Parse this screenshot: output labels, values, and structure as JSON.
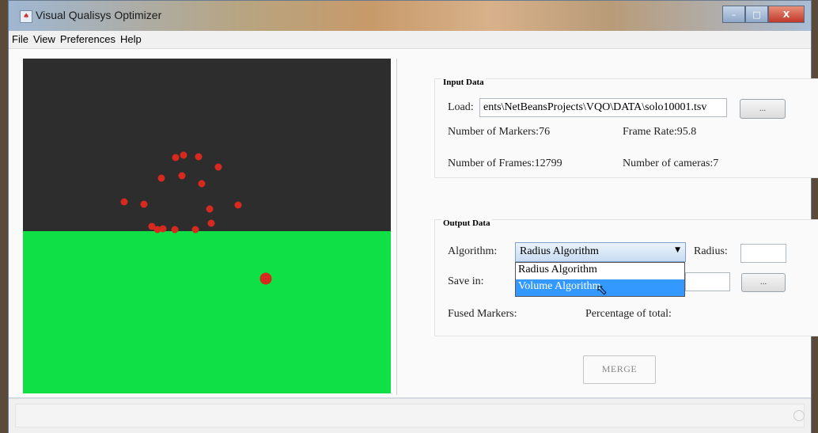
{
  "window": {
    "title": "Visual Qualisys Optimizer",
    "min_label": "–",
    "max_label": "□",
    "close_label": "X"
  },
  "menu": [
    "File",
    "View",
    "Preferences",
    "Help"
  ],
  "canvas": {
    "colors": {
      "sky": "#2d2d2d",
      "ground": "#0fe045",
      "marker": "#d62a1f"
    }
  },
  "input": {
    "title": "Input Data",
    "load_label": "Load:",
    "load_value": "ents\\NetBeansProjects\\VQO\\DATA\\solo10001.tsv",
    "browse_label": "...",
    "markers": "Number of Markers:76",
    "frame_rate": "Frame Rate:95.8",
    "frames": "Number of Frames:12799",
    "cameras": "Number of cameras:7"
  },
  "output": {
    "title": "Output Data",
    "algorithm_label": "Algorithm:",
    "algorithm_selected": "Radius Algorithm",
    "algorithm_options": [
      "Radius Algorithm",
      "Volume Algorithm"
    ],
    "radius_label": "Radius:",
    "radius_value": "",
    "save_label": "Save in:",
    "save_value": "",
    "browse_label": "...",
    "fused_label": "Fused Markers:",
    "percentage_label": "Percentage of total:"
  },
  "merge_label": "MERGE"
}
